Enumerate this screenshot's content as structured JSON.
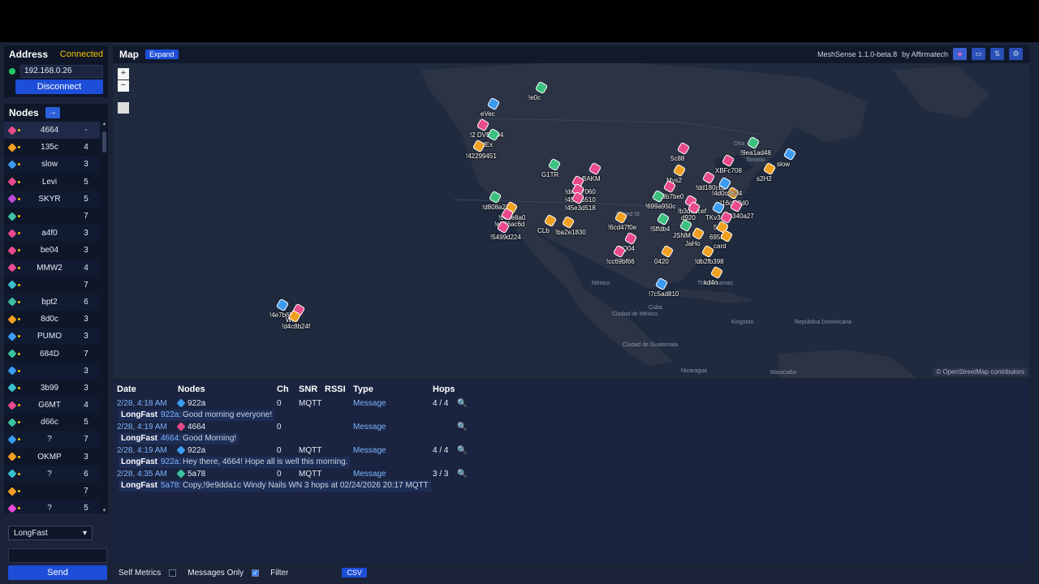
{
  "address": {
    "title": "Address",
    "status": "Connected",
    "ip": "192.168.0.26",
    "disconnect_label": "Disconnect"
  },
  "nodes": {
    "title": "Nodes",
    "arrow": "→",
    "items": [
      {
        "name": "4664",
        "hops": "-",
        "color": "#e84a8c"
      },
      {
        "name": "135c",
        "hops": "4",
        "color": "#f0a020"
      },
      {
        "name": "slow",
        "hops": "3",
        "color": "#3b9bf0"
      },
      {
        "name": "Levi",
        "hops": "5",
        "color": "#e84a8c"
      },
      {
        "name": "SKYR",
        "hops": "5",
        "color": "#c04ad8"
      },
      {
        "name": "",
        "hops": "7",
        "color": "#3bc0a0"
      },
      {
        "name": "a4f0",
        "hops": "3",
        "color": "#e84a8c"
      },
      {
        "name": "be04",
        "hops": "3",
        "color": "#e84a8c"
      },
      {
        "name": "MMW2",
        "hops": "4",
        "color": "#e84a8c"
      },
      {
        "name": "",
        "hops": "7",
        "color": "#3bc0d0"
      },
      {
        "name": "bpt2",
        "hops": "6",
        "color": "#3bc0a0"
      },
      {
        "name": "8d0c",
        "hops": "3",
        "color": "#f0a020"
      },
      {
        "name": "PUMO",
        "hops": "3",
        "color": "#3b9bf0"
      },
      {
        "name": "684D",
        "hops": "7",
        "color": "#3bc0a0"
      },
      {
        "name": "",
        "hops": "3",
        "color": "#3b9bf0"
      },
      {
        "name": "3b99",
        "hops": "3",
        "color": "#3bc0d0"
      },
      {
        "name": "G6MT",
        "hops": "4",
        "color": "#e84a8c"
      },
      {
        "name": "d66c",
        "hops": "5",
        "color": "#3bc0a0"
      },
      {
        "name": "?",
        "hops": "7",
        "color": "#3b9bf0"
      },
      {
        "name": "OKMP",
        "hops": "3",
        "color": "#f0a020"
      },
      {
        "name": "?",
        "hops": "6",
        "color": "#3bc0d0"
      },
      {
        "name": "",
        "hops": "7",
        "color": "#f0a020"
      },
      {
        "name": "?",
        "hops": "5",
        "color": "#e84ad8"
      }
    ]
  },
  "channel": {
    "selected": "LongFast"
  },
  "send_label": "Send",
  "map": {
    "title": "Map",
    "expand_label": "Expand",
    "app_version": "MeshSense 1.1.0-beta.8",
    "by": "by Affirmatech",
    "attribution": "© OpenStreetMap contributors",
    "zoom_in": "+",
    "zoom_out": "−",
    "places": [
      "México",
      "Ciudad de México",
      "Cuba",
      "The Bahamas",
      "Kingston",
      "Ciudad de Guatemala",
      "Nicaragua",
      "República Dominicana",
      "Maracaibo",
      "Toronto",
      "Otta",
      "United St"
    ],
    "markers": [
      {
        "label": "!e0c",
        "color": "#3bc080"
      },
      {
        "label": "eVec",
        "color": "#3b9bf0"
      },
      {
        "label": "!2 DVEND4",
        "color": "#e84a8c"
      },
      {
        "label": "NEx",
        "color": "#3bc080"
      },
      {
        "label": "!42299451",
        "color": "#f0a020"
      },
      {
        "label": "G1TR",
        "color": "#3bc080"
      },
      {
        "label": "BAKM",
        "color": "#e84a8c"
      },
      {
        "label": "!da837060",
        "color": "#e84a8c"
      },
      {
        "label": "!4573b510",
        "color": "#e84a8c"
      },
      {
        "label": "!45e3d518",
        "color": "#e84a8c"
      },
      {
        "label": "!d808a275",
        "color": "#3bc080"
      },
      {
        "label": "!668e8a0",
        "color": "#f0a020"
      },
      {
        "label": "!eb76ac6d",
        "color": "#e84a8c"
      },
      {
        "label": "CLb",
        "color": "#f0a020"
      },
      {
        "label": "!5499d224",
        "color": "#e84a8c"
      },
      {
        "label": "!ba2e1830",
        "color": "#f0a020"
      },
      {
        "label": "!6cd47f0e",
        "color": "#f0a020"
      },
      {
        "label": "5c88",
        "color": "#e84a8c"
      },
      {
        "label": "!9ea1ad48",
        "color": "#3bc080"
      },
      {
        "label": "slow",
        "color": "#3b9bf0"
      },
      {
        "label": "XBFc708",
        "color": "#e84a8c"
      },
      {
        "label": "Mys2",
        "color": "#f0a020"
      },
      {
        "label": "!dd180cb2",
        "color": "#e84a8c"
      },
      {
        "label": "!43b7be0",
        "color": "#e84a8c"
      },
      {
        "label": "!699a950c",
        "color": "#3bc080"
      },
      {
        "label": "!b3d8bcef",
        "color": "#e84a8c"
      },
      {
        "label": "!16cfa2d0",
        "color": "#f0a020"
      },
      {
        "label": "!44340a27",
        "color": "#e84a8c"
      },
      {
        "label": "!5ffdb4",
        "color": "#3bc080"
      },
      {
        "label": "d920",
        "color": "#e84a8c"
      },
      {
        "label": "TKv3",
        "color": "#3b9bf0"
      },
      {
        "label": "JSNM",
        "color": "#3bc080"
      },
      {
        "label": "514b",
        "color": "#e84a8c"
      },
      {
        "label": "JaHo",
        "color": "#f0a020"
      },
      {
        "label": "6958",
        "color": "#f0a020"
      },
      {
        "label": "card",
        "color": "#f0a020"
      },
      {
        "label": "DQ04",
        "color": "#e84a8c"
      },
      {
        "label": "!cc69bf66",
        "color": "#e84a8c"
      },
      {
        "label": "0420",
        "color": "#f0a020"
      },
      {
        "label": "!db2fb398",
        "color": "#f0a020"
      },
      {
        "label": "kd4n",
        "color": "#f0a020"
      },
      {
        "label": "!7c5ad810",
        "color": "#3b9bf0"
      },
      {
        "label": "!4e7b6940",
        "color": "#3b9bf0"
      },
      {
        "label": "WR",
        "color": "#e84a8c"
      },
      {
        "label": "!d4c8b24f",
        "color": "#f0a020"
      },
      {
        "label": "s2H2",
        "color": "#f0a020"
      },
      {
        "label": "!4d0c3634",
        "color": "#3b9bf0"
      }
    ]
  },
  "log": {
    "headers": {
      "date": "Date",
      "nodes": "Nodes",
      "ch": "Ch",
      "snr": "SNR",
      "rssi": "RSSI",
      "type": "Type",
      "hops": "Hops"
    },
    "rows": [
      {
        "date": "2/28, 4:18 AM",
        "node": "922a",
        "node_color": "#3b9bf0",
        "ch": "0",
        "snr": "MQTT",
        "rssi": "",
        "type": "Message",
        "hops": "4 / 4",
        "msg_channel": "LongFast",
        "msg_from": "922a:",
        "msg_text": "Good morning everyone!"
      },
      {
        "date": "2/28, 4:19 AM",
        "node": "4664",
        "node_color": "#e84a8c",
        "ch": "0",
        "snr": "",
        "rssi": "",
        "type": "Message",
        "hops": "",
        "msg_channel": "LongFast",
        "msg_from": "4664:",
        "msg_text": "Good Morning!"
      },
      {
        "date": "2/28, 4:19 AM",
        "node": "922a",
        "node_color": "#3b9bf0",
        "ch": "0",
        "snr": "MQTT",
        "rssi": "",
        "type": "Message",
        "hops": "4 / 4",
        "msg_channel": "LongFast",
        "msg_from": "922a:",
        "msg_text": "Hey there, 4664! Hope all is well this morning."
      },
      {
        "date": "2/28, 4:35 AM",
        "node": "5a78",
        "node_color": "#3bc0a0",
        "ch": "0",
        "snr": "MQTT",
        "rssi": "",
        "type": "Message",
        "hops": "3 / 3",
        "msg_channel": "LongFast",
        "msg_from": "5a78:",
        "msg_text": "Copy,!9e9dda1c Windy Nails WN 3 hops at 02/24/2026 20:17 MQTT"
      }
    ]
  },
  "bottom": {
    "self_metrics": "Self Metrics",
    "messages_only": "Messages Only",
    "filter": "Filter",
    "csv": "CSV"
  }
}
